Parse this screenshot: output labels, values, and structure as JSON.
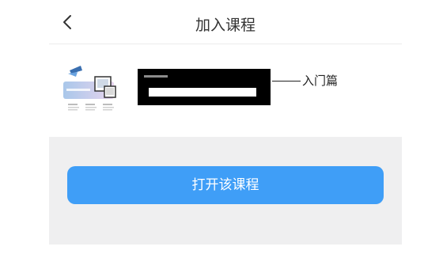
{
  "header": {
    "back_icon": "chevron-left-icon",
    "title": "加入课程"
  },
  "course": {
    "thumbnail_icon": "course-thumbnail-image",
    "name_suffix": "入门篇"
  },
  "actions": {
    "open_button_label": "打开该课程"
  },
  "colors": {
    "accent": "#3f9ef7",
    "panel_bg": "#efeff0"
  }
}
